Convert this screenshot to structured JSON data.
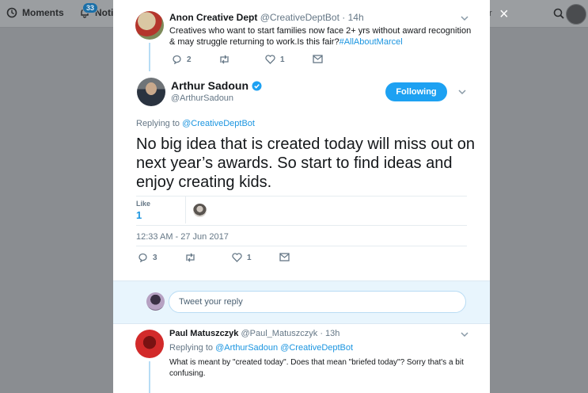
{
  "background": {
    "moments_label": "Moments",
    "notifications_label": "Notifi",
    "notifications_badge": "33",
    "search_tail": "r"
  },
  "parent_tweet": {
    "name": "Anon Creative Dept",
    "handle": "@CreativeDeptBot",
    "dot": "·",
    "time": "14h",
    "text": "Creatives who want to start families now face 2+ yrs without award recognition & may struggle returning to work.Is this fair?",
    "hashtag": "#AllAboutMarcel",
    "reply_count": "2",
    "retweet_count": "",
    "like_count": "1"
  },
  "main_tweet": {
    "name": "Arthur Sadoun",
    "handle": "@ArthurSadoun",
    "follow_label": "Following",
    "replying_prefix": "Replying to ",
    "replying_handle": "@CreativeDeptBot",
    "text": "No big idea that is created today will miss out on next year’s awards. So start to find ideas and enjoy creating kids.",
    "likes_label": "Like",
    "likes_count": "1",
    "timestamp": "12:33 AM - 27 Jun 2017",
    "reply_count": "3",
    "like_count": "1"
  },
  "composer": {
    "placeholder": "Tweet your reply"
  },
  "reply_tweet": {
    "name": "Paul Matuszczyk",
    "handle": "@Paul_Matuszczyk",
    "dot": "·",
    "time": "13h",
    "replying_prefix": "Replying to ",
    "replying_handles": "@ArthurSadoun @CreativeDeptBot",
    "text": "What is meant by \"created today\".  Does that mean \"briefed today\"? Sorry that's a bit confusing."
  },
  "colors": {
    "accent": "#1da1f2",
    "link": "#1b95e0",
    "muted": "#657786",
    "overlay": "#8a8d91"
  },
  "icons": [
    "moments-icon",
    "bell-icon",
    "search-icon",
    "close-icon",
    "chevron-down-icon",
    "reply-icon",
    "retweet-icon",
    "heart-icon",
    "envelope-icon",
    "verified-badge-icon"
  ]
}
